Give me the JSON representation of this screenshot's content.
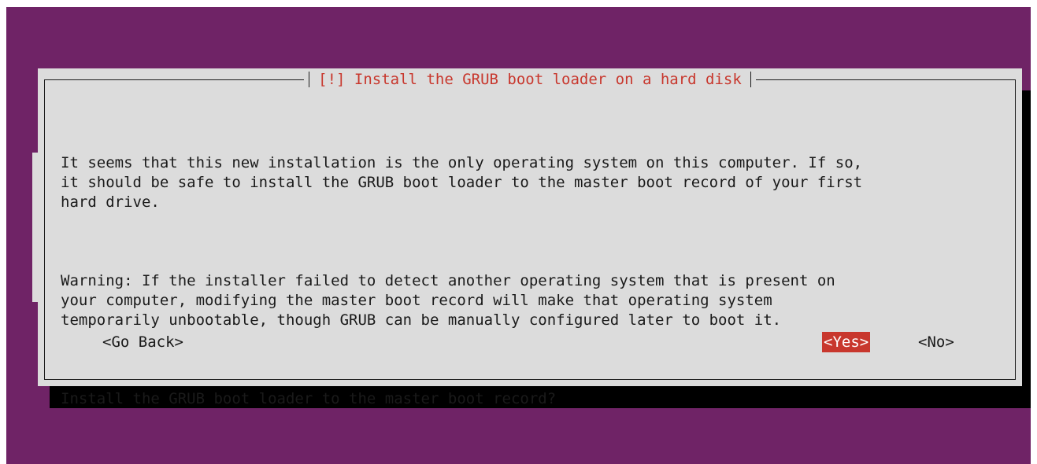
{
  "dialog": {
    "title": "[!] Install the GRUB boot loader on a hard disk",
    "paragraphs": [
      "It seems that this new installation is the only operating system on this computer. If so,\nit should be safe to install the GRUB boot loader to the master boot record of your first\nhard drive.",
      "Warning: If the installer failed to detect another operating system that is present on\nyour computer, modifying the master boot record will make that operating system\ntemporarily unbootable, though GRUB can be manually configured later to boot it.",
      "Install the GRUB boot loader to the master boot record?"
    ]
  },
  "buttons": {
    "go_back": "<Go Back>",
    "yes": "<Yes>",
    "no": "<No>"
  },
  "colors": {
    "background": "#6f2366",
    "dialog": "#dcdcdc",
    "title": "#c8372d",
    "selected_button": "#c8372d"
  }
}
